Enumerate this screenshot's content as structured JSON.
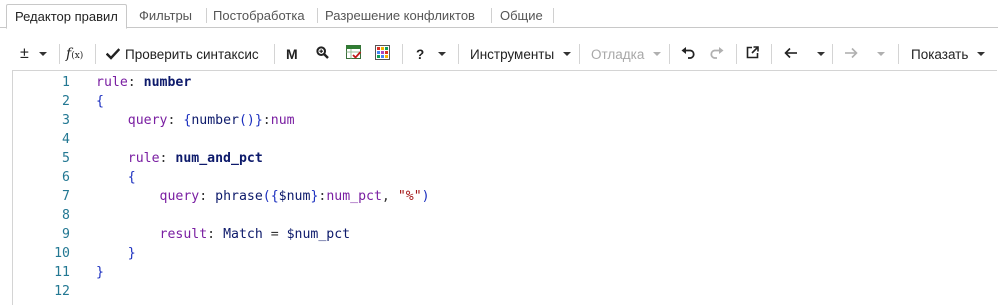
{
  "tabs": [
    {
      "label": "Редактор правил",
      "active": true
    },
    {
      "label": "Фильтры",
      "active": false
    },
    {
      "label": "Постобработка",
      "active": false
    },
    {
      "label": "Разрешение конфликтов",
      "active": false
    },
    {
      "label": "Общие",
      "active": false
    }
  ],
  "toolbar": {
    "plusminus_label": "±",
    "fx_label": "fx",
    "check_syntax_label": "Проверить синтаксис",
    "m_label": "M",
    "help_label": "?",
    "tools_label": "Инструменты",
    "debug_label": "Отладка",
    "show_label": "Показать",
    "icons": [
      "plus-minus-icon",
      "function-icon",
      "checkmark-icon",
      "search-icon",
      "table-check-icon",
      "grid-icon",
      "undo-icon",
      "redo-icon",
      "external-link-icon",
      "arrow-left-icon",
      "arrow-right-icon"
    ]
  },
  "editor": {
    "lines": [
      {
        "n": "1",
        "tokens": [
          [
            "kw",
            "rule"
          ],
          [
            "plain",
            ": "
          ],
          [
            "name",
            "number"
          ]
        ]
      },
      {
        "n": "2",
        "tokens": [
          [
            "br",
            "{"
          ]
        ]
      },
      {
        "n": "3",
        "tokens": [
          [
            "plain",
            "    "
          ],
          [
            "kw",
            "query"
          ],
          [
            "plain",
            ": "
          ],
          [
            "br",
            "{"
          ],
          [
            "fn",
            "number"
          ],
          [
            "br",
            "()"
          ],
          [
            "br",
            "}"
          ],
          [
            "plain",
            ":"
          ],
          [
            "kw",
            "num"
          ]
        ]
      },
      {
        "n": "4",
        "tokens": []
      },
      {
        "n": "5",
        "tokens": [
          [
            "plain",
            "    "
          ],
          [
            "kw",
            "rule"
          ],
          [
            "plain",
            ": "
          ],
          [
            "name",
            "num_and_pct"
          ]
        ]
      },
      {
        "n": "6",
        "tokens": [
          [
            "plain",
            "    "
          ],
          [
            "br",
            "{"
          ]
        ]
      },
      {
        "n": "7",
        "tokens": [
          [
            "plain",
            "        "
          ],
          [
            "kw",
            "query"
          ],
          [
            "plain",
            ": "
          ],
          [
            "fn",
            "phrase"
          ],
          [
            "br",
            "("
          ],
          [
            "br",
            "{"
          ],
          [
            "fn",
            "$num"
          ],
          [
            "br",
            "}"
          ],
          [
            "plain",
            ":"
          ],
          [
            "kw",
            "num_pct"
          ],
          [
            "plain",
            ", "
          ],
          [
            "str",
            "\"%\""
          ],
          [
            "br",
            ")"
          ]
        ]
      },
      {
        "n": "8",
        "tokens": []
      },
      {
        "n": "9",
        "tokens": [
          [
            "plain",
            "        "
          ],
          [
            "kw",
            "result"
          ],
          [
            "plain",
            ": "
          ],
          [
            "fn",
            "Match"
          ],
          [
            "plain",
            " = "
          ],
          [
            "fn",
            "$num_pct"
          ]
        ]
      },
      {
        "n": "10",
        "tokens": [
          [
            "plain",
            "    "
          ],
          [
            "br",
            "}"
          ]
        ]
      },
      {
        "n": "11",
        "tokens": [
          [
            "br",
            "}"
          ]
        ]
      },
      {
        "n": "12",
        "tokens": []
      }
    ]
  }
}
